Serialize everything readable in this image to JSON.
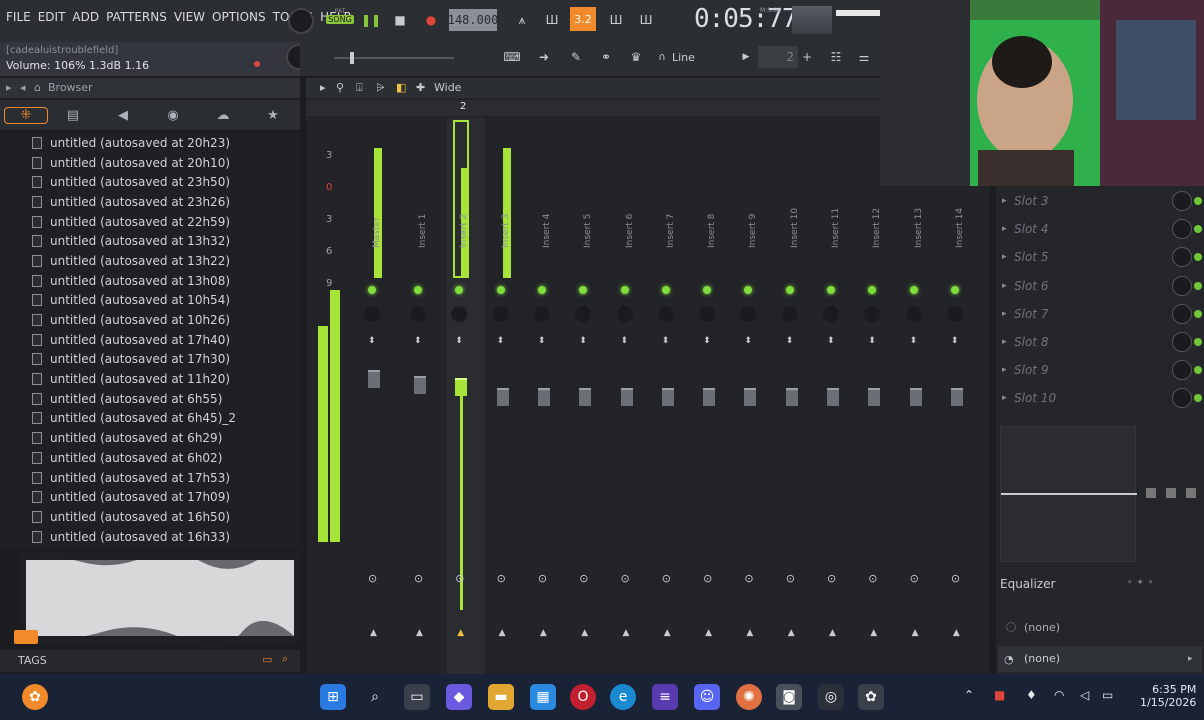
{
  "menu": [
    "FILE",
    "EDIT",
    "ADD",
    "PATTERNS",
    "VIEW",
    "OPTIONS",
    "TOOLS",
    "HELP"
  ],
  "transport": {
    "pat_label": "PAT",
    "song_label": "SONG",
    "tempo": "148.000",
    "time": "0:05:77",
    "time_unit": "M:S:CS",
    "snap_label": "Line",
    "step_value": "2",
    "mode_label": "3.2"
  },
  "hint": {
    "title": "[cadealuistroublefield]",
    "volume": "Volume: 106%  1.3dB  1.16"
  },
  "browser": {
    "title": "Browser",
    "files": [
      "untitled (autosaved at 20h23)",
      "untitled (autosaved at 20h10)",
      "untitled (autosaved at 23h50)",
      "untitled (autosaved at 23h26)",
      "untitled (autosaved at 22h59)",
      "untitled (autosaved at 13h32)",
      "untitled (autosaved at 13h22)",
      "untitled (autosaved at 13h08)",
      "untitled (autosaved at 10h54)",
      "untitled (autosaved at 10h26)",
      "untitled (autosaved at 17h40)",
      "untitled (autosaved at 17h30)",
      "untitled (autosaved at 11h20)",
      "untitled (autosaved at 6h55)",
      "untitled (autosaved at 6h45)_2",
      "untitled (autosaved at 6h29)",
      "untitled (autosaved at 6h02)",
      "untitled (autosaved at 17h53)",
      "untitled (autosaved at 17h09)",
      "untitled (autosaved at 16h50)",
      "untitled (autosaved at 16h33)"
    ],
    "tags_label": "TAGS"
  },
  "mixer": {
    "view_label": "Wide",
    "scale": [
      "3",
      "0",
      "3",
      "6",
      "9"
    ],
    "tracks": [
      "Master",
      "Insert 1",
      "Insert 2",
      "Insert 3",
      "Insert 4",
      "Insert 5",
      "Insert 6",
      "Insert 7",
      "Insert 8",
      "Insert 9",
      "Insert 10",
      "Insert 11",
      "Insert 12",
      "Insert 13",
      "Insert 14"
    ],
    "selected_track": "Insert 2",
    "ruler_current": "2"
  },
  "fx": {
    "slots": [
      "Slot 3",
      "Slot 4",
      "Slot 5",
      "Slot 6",
      "Slot 7",
      "Slot 8",
      "Slot 9",
      "Slot 10"
    ],
    "eq_label": "Equalizer",
    "input_route": "(none)",
    "output_route": "(none)"
  },
  "taskbar": {
    "time": "6:35 PM",
    "date": "1/15/2026"
  },
  "colors": {
    "accent": "#f08a2a",
    "meter_green": "#a6e43a",
    "led_green": "#7fdc3a"
  }
}
